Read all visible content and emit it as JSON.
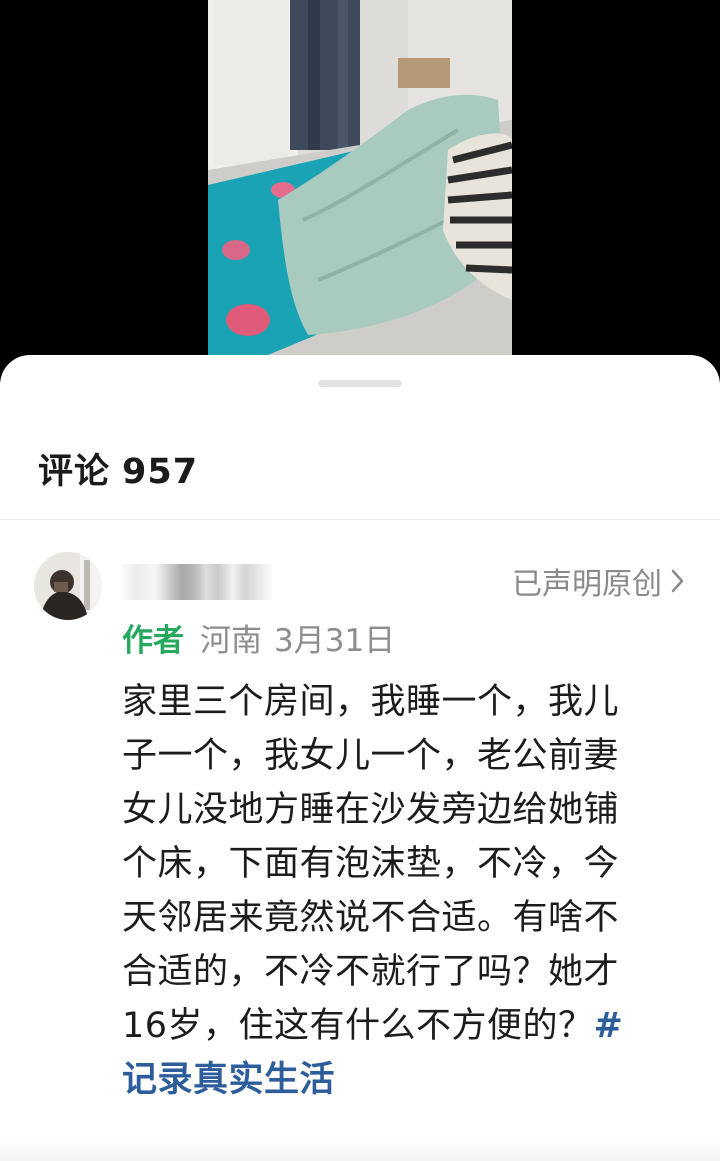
{
  "comments_panel": {
    "title_label": "评论",
    "title_count": "957"
  },
  "comment": {
    "original_label": "已声明原创",
    "chevron_icon": "chevron-right-icon",
    "author_badge": "作者",
    "location": "河南",
    "date": "3月31日",
    "body_lines": [
      "家里三个房间，我睡一个，我儿",
      "子一个，我女儿一个，老公前妻",
      "女儿没地方睡在沙发旁边给她铺",
      "个床，下面有泡沫垫，不冷，今",
      "天邻居来竟然说不合适。有啥不",
      "合适的，不冷不就行了吗？她才"
    ],
    "body_line7_text": "16岁，住这有什么不方便的？",
    "hashtag_start": "#",
    "hashtag_text": "记录真实生活"
  },
  "colors": {
    "author_green": "#26a85f",
    "hashtag_blue": "#2d5d9b",
    "meta_gray": "#8d8d8d"
  }
}
